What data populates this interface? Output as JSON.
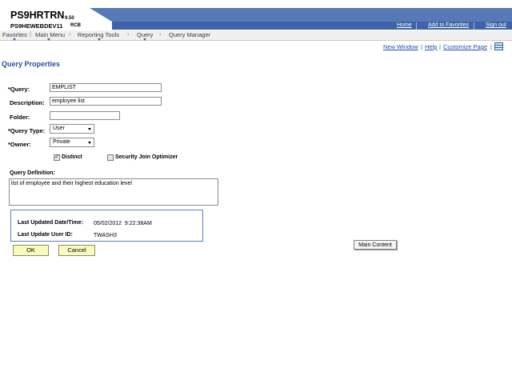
{
  "header": {
    "system_name": "PS9HRTRN",
    "system_version": "9.50",
    "database_name": "PS9HEWEBDEV11",
    "user_code": "RCB",
    "links": {
      "home": "Home",
      "add_to_favorites": "Add to Favorites",
      "sign_out": "Sign out"
    }
  },
  "nav": {
    "favorites": "Favorites",
    "main_menu": "Main Menu",
    "breadcrumbs": [
      "Reporting Tools",
      "Query",
      "Query Manager"
    ],
    "separator": "›"
  },
  "pagelet_links": {
    "new_window": "New Window",
    "help": "Help",
    "customize_page": "Customize Page",
    "separator": "|"
  },
  "page_title": "Query Properties",
  "form": {
    "query": {
      "label": "*Query:",
      "value": "EMPLIST"
    },
    "description": {
      "label": "Description:",
      "value": "employee list"
    },
    "folder": {
      "label": "Folder:",
      "value": ""
    },
    "query_type": {
      "label": "*Query Type:",
      "value": "User"
    },
    "owner": {
      "label": "*Owner:",
      "value": "Private"
    },
    "distinct": {
      "label": "Distinct",
      "checked": true
    },
    "security_join_optimizer": {
      "label": "Security Join Optimizer",
      "checked": false
    },
    "query_definition": {
      "label": "Query Definition:",
      "value": "list of employee and their highest education level"
    }
  },
  "last_updated": {
    "datetime_label": "Last Updated Date/Time:",
    "datetime_value": "05/02/2012  9:22:38AM",
    "user_label": "Last Update User ID:",
    "user_value": "TWASH3"
  },
  "buttons": {
    "ok": "OK",
    "cancel": "Cancel"
  },
  "tooltip": "Main Content",
  "colors": {
    "header_blue": "#5779b8",
    "title_blue": "#2b4f9c",
    "link_blue": "#1d4dad",
    "button_yellow": "#fafabf"
  }
}
